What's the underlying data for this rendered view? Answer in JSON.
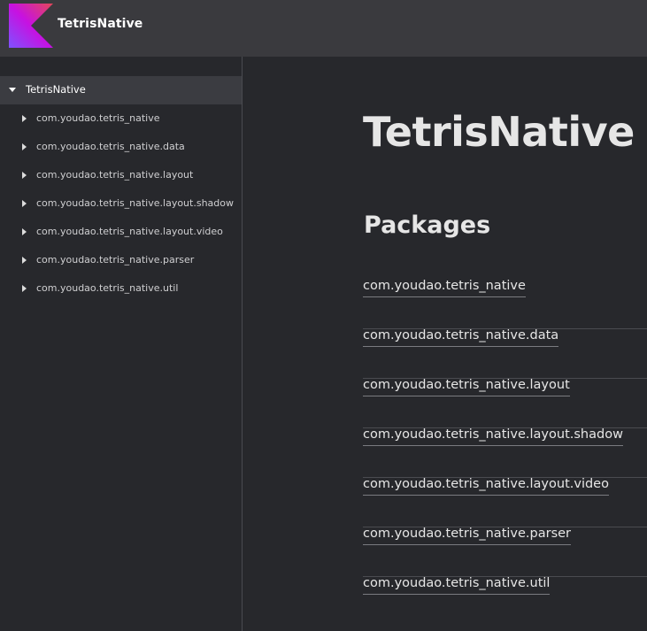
{
  "header": {
    "app_title": "TetrisNative",
    "logo_icon": "kotlin-logo-icon",
    "logo_colors": [
      "#e44857",
      "#c711e1",
      "#7f52ff"
    ]
  },
  "sidebar": {
    "root": {
      "label": "TetrisNative",
      "expanded": true
    },
    "items": [
      {
        "label": "com.youdao.tetris_native"
      },
      {
        "label": "com.youdao.tetris_native.data"
      },
      {
        "label": "com.youdao.tetris_native.layout"
      },
      {
        "label": "com.youdao.tetris_native.layout.shadow"
      },
      {
        "label": "com.youdao.tetris_native.layout.video"
      },
      {
        "label": "com.youdao.tetris_native.parser"
      },
      {
        "label": "com.youdao.tetris_native.util"
      }
    ]
  },
  "main": {
    "title": "TetrisNative",
    "section_title": "Packages",
    "packages": [
      {
        "name": "com.youdao.tetris_native"
      },
      {
        "name": "com.youdao.tetris_native.data"
      },
      {
        "name": "com.youdao.tetris_native.layout"
      },
      {
        "name": "com.youdao.tetris_native.layout.shadow"
      },
      {
        "name": "com.youdao.tetris_native.layout.video"
      },
      {
        "name": "com.youdao.tetris_native.parser"
      },
      {
        "name": "com.youdao.tetris_native.util"
      }
    ]
  },
  "colors": {
    "background": "#27282c",
    "header": "#3a3a3e",
    "selected_row": "#3b3c41",
    "text": "#e6e6e6"
  }
}
